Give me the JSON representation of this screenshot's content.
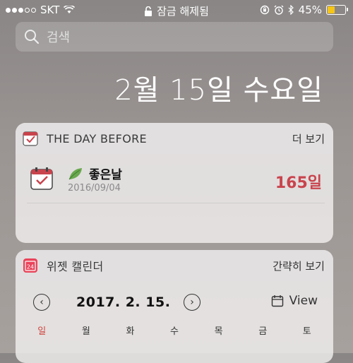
{
  "status_bar": {
    "carrier": "SKT",
    "center_label": "잠금 해제됨",
    "battery_percent": "45%",
    "battery_level": 0.45
  },
  "search": {
    "placeholder": "검색"
  },
  "date_header": "2월 15일 수요일",
  "widgets": {
    "dday": {
      "title": "THE DAY BEFORE",
      "more_label": "더 보기",
      "item": {
        "name": "좋은날",
        "date": "2016/09/04",
        "count": "165일"
      }
    },
    "calendar": {
      "icon_number": "24",
      "title": "위젯 캘린더",
      "more_label": "간략히 보기",
      "current_date": "2017. 2. 15.",
      "view_label": "View",
      "weekdays": [
        "일",
        "월",
        "화",
        "수",
        "목",
        "금",
        "토"
      ]
    }
  },
  "colors": {
    "accent_red": "#c9444d",
    "battery_yellow": "#f5c518",
    "calendar_icon_red": "#e9445a"
  }
}
